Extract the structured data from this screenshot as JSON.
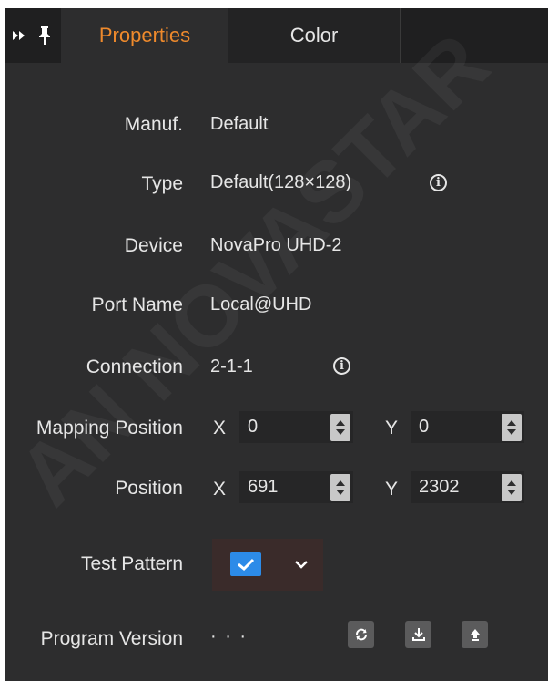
{
  "tabs": [
    {
      "label": "Properties",
      "active": true
    },
    {
      "label": "Color",
      "active": false
    }
  ],
  "toolbar_icons": [
    "expand-double-chevron-icon",
    "pin-icon"
  ],
  "properties": {
    "manufacturer": {
      "label": "Manuf.",
      "value": "Default"
    },
    "type": {
      "label": "Type",
      "value": "Default(128×128)",
      "info_glyph": "i"
    },
    "device": {
      "label": "Device",
      "value": "NovaPro UHD-2"
    },
    "port_name": {
      "label": "Port Name",
      "value": "Local@UHD"
    },
    "connection": {
      "label": "Connection",
      "value": "2-1-1",
      "info_glyph": "i"
    },
    "mapping_position": {
      "label": "Mapping Position",
      "x_label": "X",
      "x_value": "0",
      "y_label": "Y",
      "y_value": "0"
    },
    "position": {
      "label": "Position",
      "x_label": "X",
      "x_value": "691",
      "y_label": "Y",
      "y_value": "2302"
    },
    "test_pattern": {
      "label": "Test Pattern",
      "checked": true
    },
    "program_version": {
      "label": "Program Version",
      "value": "· · ·",
      "actions": [
        "refresh-icon",
        "download-icon",
        "upload-icon"
      ]
    }
  },
  "colors": {
    "accent": "#ef8a2c",
    "panel_bg": "#2d2d2e",
    "tabbar_bg": "#1f1f20",
    "checkbox_blue": "#2c8be8",
    "text": "#e6e6e6"
  },
  "watermark": "AN NOVASTAR"
}
